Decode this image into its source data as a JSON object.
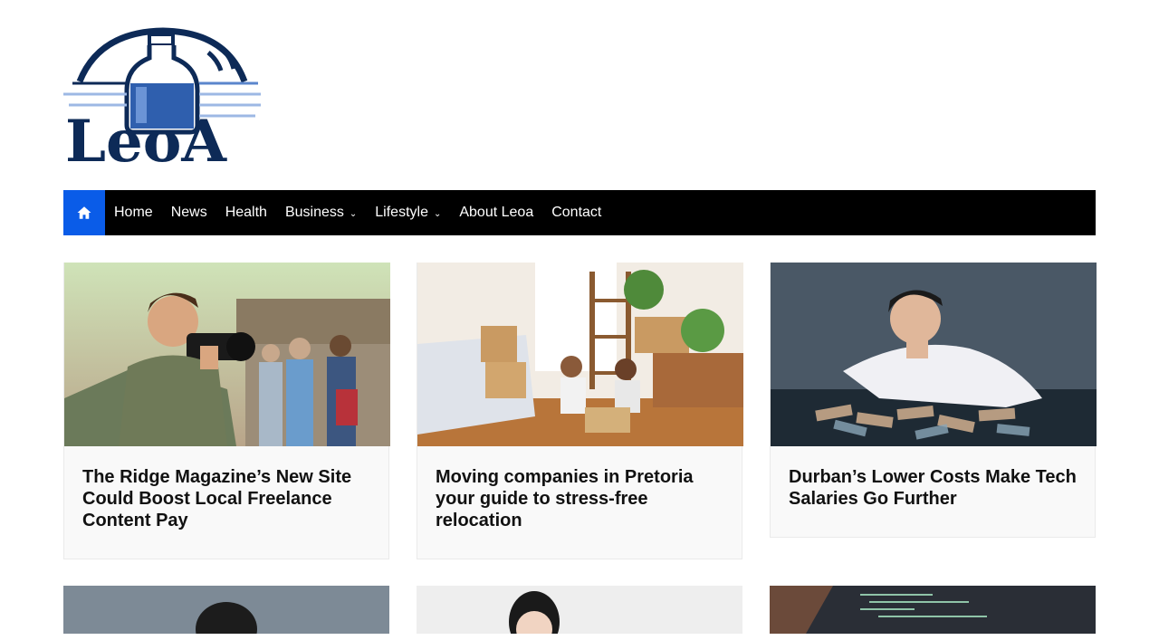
{
  "site": {
    "logo_text": "LeoA"
  },
  "nav": {
    "home_icon": "home-icon",
    "items": [
      {
        "label": "Home"
      },
      {
        "label": "News"
      },
      {
        "label": "Health"
      },
      {
        "label": "Business",
        "has_dropdown": true
      },
      {
        "label": "Lifestyle",
        "has_dropdown": true
      },
      {
        "label": "About Leoa"
      },
      {
        "label": "Contact"
      }
    ],
    "colors": {
      "bar": "#000000",
      "home_bg": "#0a5ce8"
    }
  },
  "cards": [
    {
      "title": "The Ridge Magazine’s New Site Could Boost Local Freelance Content Pay"
    },
    {
      "title": "Moving companies in Pretoria your guide to stress-free relocation"
    },
    {
      "title": "Durban’s Lower Costs Make Tech Salaries Go Further"
    }
  ]
}
